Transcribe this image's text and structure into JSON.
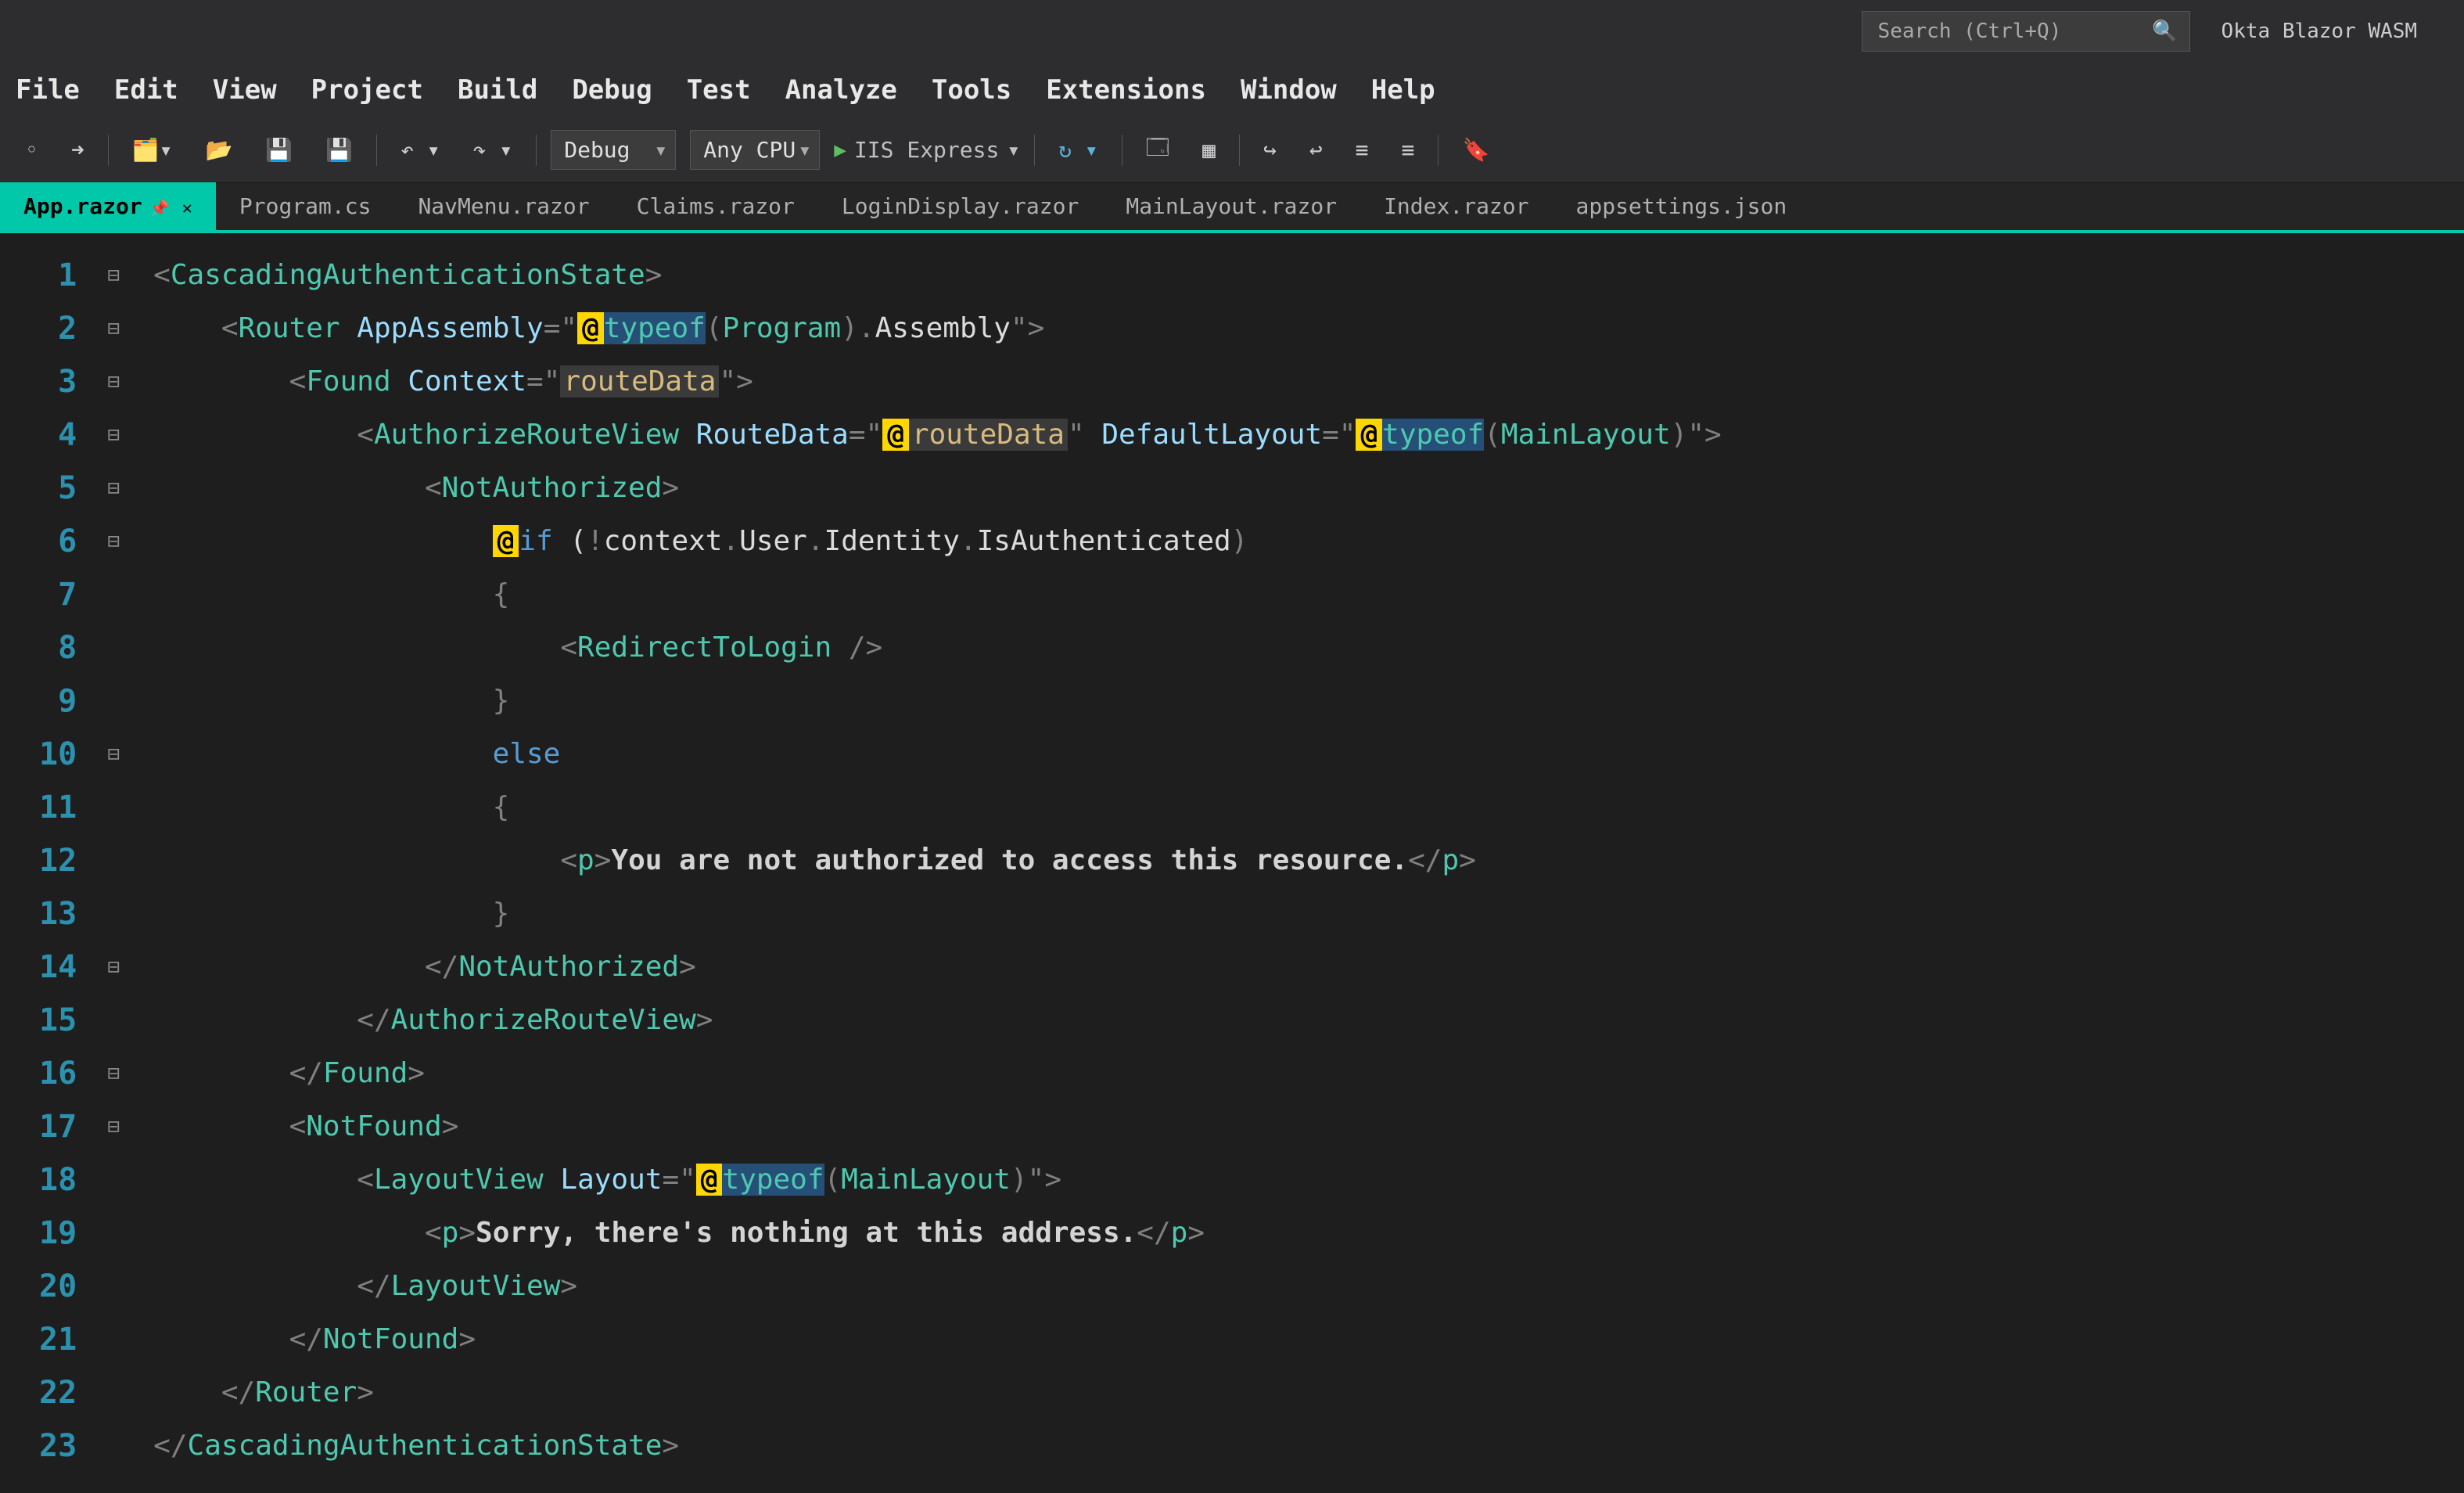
{
  "titlebar": {
    "search_placeholder": "Search (Ctrl+Q)",
    "solution_name": "Okta Blazor WASM"
  },
  "menu": [
    "File",
    "Edit",
    "View",
    "Project",
    "Build",
    "Debug",
    "Test",
    "Analyze",
    "Tools",
    "Extensions",
    "Window",
    "Help"
  ],
  "toolbar": {
    "config": "Debug",
    "platform": "Any CPU",
    "run_target": "IIS Express"
  },
  "tabs": [
    {
      "label": "App.razor",
      "active": true
    },
    {
      "label": "Program.cs",
      "active": false
    },
    {
      "label": "NavMenu.razor",
      "active": false
    },
    {
      "label": "Claims.razor",
      "active": false
    },
    {
      "label": "LoginDisplay.razor",
      "active": false
    },
    {
      "label": "MainLayout.razor",
      "active": false
    },
    {
      "label": "Index.razor",
      "active": false
    },
    {
      "label": "appsettings.json",
      "active": false
    }
  ],
  "editor": {
    "line_count": 23,
    "fold_markers": [
      1,
      2,
      3,
      4,
      5,
      6,
      10,
      14,
      16,
      17
    ],
    "code_tokens": [
      [
        [
          "punct",
          "<"
        ],
        [
          "tag",
          "CascadingAuthenticationState"
        ],
        [
          "punct",
          ">"
        ]
      ],
      [
        [
          "id",
          "    "
        ],
        [
          "punct",
          "<"
        ],
        [
          "tag",
          "Router"
        ],
        [
          "id",
          " "
        ],
        [
          "attr",
          "AppAssembly"
        ],
        [
          "punct",
          "=\""
        ],
        [
          "at",
          "@"
        ],
        [
          "hl",
          "typeof"
        ],
        [
          "punct",
          "("
        ],
        [
          "type",
          "Program"
        ],
        [
          "punct",
          ")."
        ],
        [
          "id",
          "Assembly"
        ],
        [
          "punct",
          "\">"
        ]
      ],
      [
        [
          "id",
          "        "
        ],
        [
          "punct",
          "<"
        ],
        [
          "tag",
          "Found"
        ],
        [
          "id",
          " "
        ],
        [
          "attr",
          "Context"
        ],
        [
          "punct",
          "=\""
        ],
        [
          "str",
          "routeData"
        ],
        [
          "punct",
          "\">"
        ]
      ],
      [
        [
          "id",
          "            "
        ],
        [
          "punct",
          "<"
        ],
        [
          "tag",
          "AuthorizeRouteView"
        ],
        [
          "id",
          " "
        ],
        [
          "attr",
          "RouteData"
        ],
        [
          "punct",
          "=\""
        ],
        [
          "at",
          "@"
        ],
        [
          "str",
          "routeData"
        ],
        [
          "punct",
          "\" "
        ],
        [
          "attr",
          "DefaultLayout"
        ],
        [
          "punct",
          "=\""
        ],
        [
          "at",
          "@"
        ],
        [
          "hl",
          "typeof"
        ],
        [
          "punct",
          "("
        ],
        [
          "type",
          "MainLayout"
        ],
        [
          "punct",
          ")\">"
        ]
      ],
      [
        [
          "id",
          "                "
        ],
        [
          "punct",
          "<"
        ],
        [
          "tag",
          "NotAuthorized"
        ],
        [
          "punct",
          ">"
        ]
      ],
      [
        [
          "id",
          "                    "
        ],
        [
          "at",
          "@"
        ],
        [
          "kw",
          "if"
        ],
        [
          "id",
          " ("
        ],
        [
          "punct",
          "!"
        ],
        [
          "id",
          "context"
        ],
        [
          "punct",
          "."
        ],
        [
          "id",
          "User"
        ],
        [
          "punct",
          "."
        ],
        [
          "id",
          "Identity"
        ],
        [
          "punct",
          "."
        ],
        [
          "id",
          "IsAuthenticated"
        ],
        [
          "punct",
          ")"
        ]
      ],
      [
        [
          "id",
          "                    "
        ],
        [
          "punct",
          "{"
        ]
      ],
      [
        [
          "id",
          "                        "
        ],
        [
          "punct",
          "<"
        ],
        [
          "tag",
          "RedirectToLogin"
        ],
        [
          "id",
          " "
        ],
        [
          "punct",
          "/>"
        ]
      ],
      [
        [
          "id",
          "                    "
        ],
        [
          "punct",
          "}"
        ]
      ],
      [
        [
          "id",
          "                    "
        ],
        [
          "kw",
          "else"
        ]
      ],
      [
        [
          "id",
          "                    "
        ],
        [
          "punct",
          "{"
        ]
      ],
      [
        [
          "id",
          "                        "
        ],
        [
          "punct",
          "<"
        ],
        [
          "tag",
          "p"
        ],
        [
          "punct",
          ">"
        ],
        [
          "txt",
          "You are not authorized to access this resource."
        ],
        [
          "punct",
          "</"
        ],
        [
          "tag",
          "p"
        ],
        [
          "punct",
          ">"
        ]
      ],
      [
        [
          "id",
          "                    "
        ],
        [
          "punct",
          "}"
        ]
      ],
      [
        [
          "id",
          "                "
        ],
        [
          "punct",
          "</"
        ],
        [
          "tag",
          "NotAuthorized"
        ],
        [
          "punct",
          ">"
        ]
      ],
      [
        [
          "id",
          "            "
        ],
        [
          "punct",
          "</"
        ],
        [
          "tag",
          "AuthorizeRouteView"
        ],
        [
          "punct",
          ">"
        ]
      ],
      [
        [
          "id",
          "        "
        ],
        [
          "punct",
          "</"
        ],
        [
          "tag",
          "Found"
        ],
        [
          "punct",
          ">"
        ]
      ],
      [
        [
          "id",
          "        "
        ],
        [
          "punct",
          "<"
        ],
        [
          "tag",
          "NotFound"
        ],
        [
          "punct",
          ">"
        ]
      ],
      [
        [
          "id",
          "            "
        ],
        [
          "punct",
          "<"
        ],
        [
          "tag",
          "LayoutView"
        ],
        [
          "id",
          " "
        ],
        [
          "attr",
          "Layout"
        ],
        [
          "punct",
          "=\""
        ],
        [
          "at",
          "@"
        ],
        [
          "hl",
          "typeof"
        ],
        [
          "punct",
          "("
        ],
        [
          "type",
          "MainLayout"
        ],
        [
          "punct",
          ")\">"
        ]
      ],
      [
        [
          "id",
          "                "
        ],
        [
          "punct",
          "<"
        ],
        [
          "tag",
          "p"
        ],
        [
          "punct",
          ">"
        ],
        [
          "txt",
          "Sorry, there's nothing at this address."
        ],
        [
          "punct",
          "</"
        ],
        [
          "tag",
          "p"
        ],
        [
          "punct",
          ">"
        ]
      ],
      [
        [
          "id",
          "            "
        ],
        [
          "punct",
          "</"
        ],
        [
          "tag",
          "LayoutView"
        ],
        [
          "punct",
          ">"
        ]
      ],
      [
        [
          "id",
          "        "
        ],
        [
          "punct",
          "</"
        ],
        [
          "tag",
          "NotFound"
        ],
        [
          "punct",
          ">"
        ]
      ],
      [
        [
          "id",
          "    "
        ],
        [
          "punct",
          "</"
        ],
        [
          "tag",
          "Router"
        ],
        [
          "punct",
          ">"
        ]
      ],
      [
        [
          "punct",
          "</"
        ],
        [
          "tag",
          "CascadingAuthenticationState"
        ],
        [
          "punct",
          ">"
        ]
      ]
    ]
  }
}
